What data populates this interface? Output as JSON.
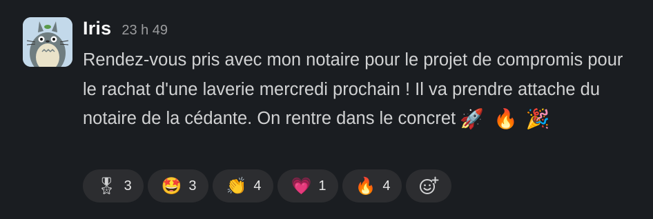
{
  "message": {
    "author": "Iris",
    "time": "23 h 49",
    "text": "Rendez-vous pris avec mon notaire pour le projet de compromis pour le rachat d'une laverie mercredi prochain ! Il va prendre attache du notaire de la cédante. On rentre dans le concret",
    "trailing_emojis": [
      {
        "glyph": "🚀",
        "icon": "rocket"
      },
      {
        "glyph": "🔥",
        "icon": "fire"
      },
      {
        "glyph": "🎉",
        "icon": "party-popper"
      }
    ]
  },
  "reactions": [
    {
      "glyph": "🎖",
      "icon": "military-medal",
      "count": "3"
    },
    {
      "glyph": "🤩",
      "icon": "star-struck-face",
      "count": "3"
    },
    {
      "glyph": "👏",
      "icon": "clapping-hands",
      "count": "4"
    },
    {
      "glyph": "💗",
      "icon": "growing-heart",
      "count": "1"
    },
    {
      "glyph": "🔥",
      "icon": "fire",
      "count": "4"
    }
  ],
  "add_reaction_icon": "add-reaction-icon",
  "colors": {
    "background": "#1a1d21",
    "text": "#d1d2d3",
    "author": "#f8f8f8",
    "timestamp": "#9b9c9e",
    "pill": "#2c2d30"
  }
}
